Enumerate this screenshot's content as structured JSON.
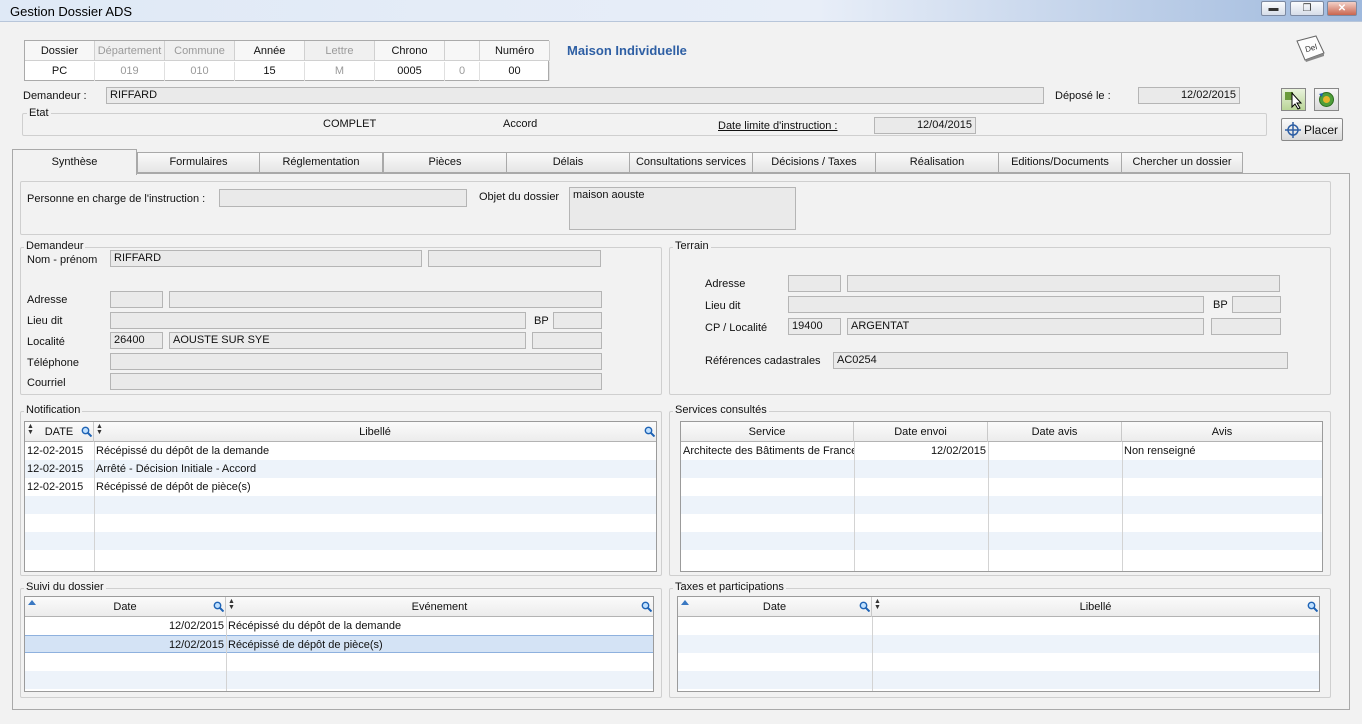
{
  "window": {
    "title": "Gestion Dossier ADS",
    "btn_min": "▬",
    "btn_max": "❐",
    "btn_close": "✕"
  },
  "dossier_grid": {
    "headers": [
      "Dossier",
      "Département",
      "Commune",
      "Année",
      "Lettre",
      "Chrono",
      "",
      "Numéro"
    ],
    "values": [
      "PC",
      "019",
      "010",
      "15",
      "M",
      "0005",
      "0",
      "00"
    ]
  },
  "dossier_type": "Maison Individuelle",
  "del_button": "Del",
  "placer_button": "Placer",
  "header": {
    "demandeur_label": "Demandeur :",
    "demandeur_value": "RIFFARD",
    "depose_label": "Déposé le :",
    "depose_value": "12/02/2015",
    "etat_legend": "Etat",
    "etat_status": "COMPLET",
    "etat_decision": "Accord",
    "date_limite_label": "Date limite d'instruction :",
    "date_limite_value": "12/04/2015"
  },
  "tabs": [
    "Synthèse",
    "Formulaires",
    "Réglementation",
    "Pièces",
    "Délais",
    "Consultations services",
    "Décisions / Taxes",
    "Réalisation",
    "Editions/Documents",
    "Chercher un dossier"
  ],
  "synthese": {
    "personne_label": "Personne en charge de l'instruction :",
    "personne_value": "",
    "objet_label": "Objet du dossier",
    "objet_value": "maison aouste"
  },
  "demandeur": {
    "legend": "Demandeur",
    "nom_label": "Nom  - prénom",
    "nom_value": "RIFFARD",
    "prenom_value": "",
    "adresse_label": "Adresse",
    "adresse_num": "",
    "adresse_value": "",
    "lieu_dit_label": "Lieu dit",
    "lieu_dit_value": "",
    "bp_label": "BP",
    "bp_value": "",
    "localite_label": "Localité",
    "cp_value": "26400",
    "ville_value": "AOUSTE SUR SYE",
    "localite_extra": "",
    "telephone_label": "Téléphone",
    "telephone_value": "",
    "courriel_label": "Courriel",
    "courriel_value": ""
  },
  "terrain": {
    "legend": "Terrain",
    "adresse_label": "Adresse",
    "adresse_num": "",
    "adresse_value": "",
    "lieu_dit_label": "Lieu dit",
    "lieu_dit_value": "",
    "bp_label": "BP",
    "bp_value": "",
    "cp_label": "CP / Localité",
    "cp_value": "19400",
    "ville_value": "ARGENTAT",
    "extra_value": "",
    "ref_label": "Références cadastrales",
    "ref_value": "AC0254"
  },
  "notification": {
    "legend": "Notification",
    "columns": [
      "DATE",
      "Libellé"
    ],
    "rows": [
      {
        "date": "12-02-2015",
        "libelle": "Récépissé du dépôt de la demande"
      },
      {
        "date": "12-02-2015",
        "libelle": "Arrêté - Décision Initiale - Accord"
      },
      {
        "date": "12-02-2015",
        "libelle": "Récépissé de dépôt de pièce(s)"
      }
    ]
  },
  "services": {
    "legend": "Services consultés",
    "columns": [
      "Service",
      "Date envoi",
      "Date avis",
      "Avis"
    ],
    "rows": [
      {
        "service": "Architecte des Bâtiments de France",
        "date_envoi": "12/02/2015",
        "date_avis": "",
        "avis": "Non renseigné"
      }
    ]
  },
  "suivi": {
    "legend": "Suivi du dossier",
    "columns": [
      "Date",
      "Evénement"
    ],
    "rows": [
      {
        "date": "12/02/2015",
        "evenement": "Récépissé du dépôt de la demande"
      },
      {
        "date": "12/02/2015",
        "evenement": "Récépissé de dépôt de pièce(s)"
      }
    ]
  },
  "taxes": {
    "legend": "Taxes et participations",
    "columns": [
      "Date",
      "Libellé"
    ],
    "rows": []
  },
  "colors": {
    "accent": "#2e5fa4",
    "row_alt": "#edf3fa",
    "row_sel": "#d4e3f5"
  }
}
